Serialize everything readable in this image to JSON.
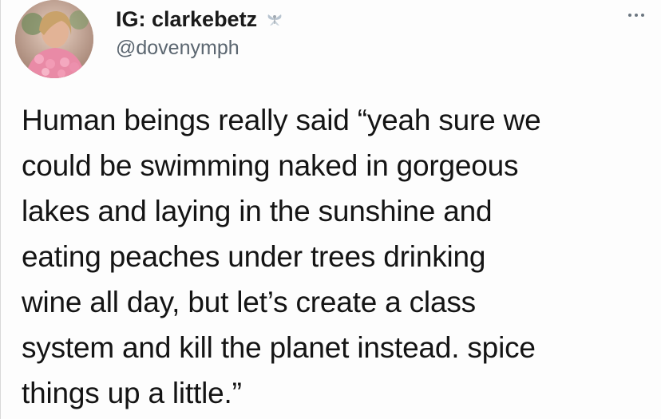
{
  "author": {
    "display_name": "IG: clarkebetz",
    "handle": "@dovenymph",
    "badge_icon": "fairy-emoji-icon",
    "avatar": "profile-photo"
  },
  "menu": {
    "icon": "more-options-icon"
  },
  "tweet": {
    "text": "Human beings really said “yeah sure we\ncould be swimming naked in gorgeous\nlakes and laying in the sunshine and\neating peaches under trees drinking\nwine all day, but let’s create a class\nsystem and kill the planet instead. spice\nthings up a little.”"
  },
  "colors": {
    "text": "#141414",
    "handle": "#5b6670",
    "background": "#fdfdfd"
  }
}
